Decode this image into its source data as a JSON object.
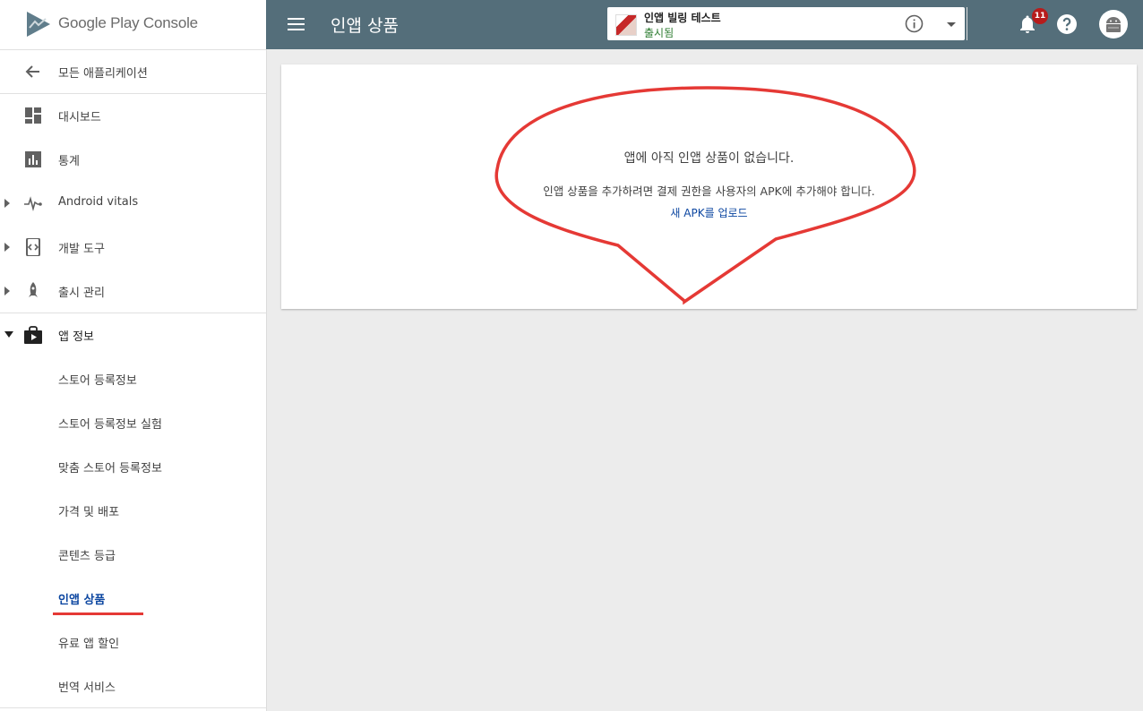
{
  "brand": {
    "name": "Google Play Console"
  },
  "sidebar": {
    "back": {
      "label": "모든 애플리케이션"
    },
    "items": [
      {
        "label": "대시보드"
      },
      {
        "label": "통계"
      },
      {
        "label": "Android vitals"
      },
      {
        "label": "개발 도구"
      },
      {
        "label": "출시 관리"
      },
      {
        "label": "앱 정보"
      }
    ],
    "sub_items": [
      {
        "label": "스토어 등록정보"
      },
      {
        "label": "스토어 등록정보 실험"
      },
      {
        "label": "맞춤 스토어 등록정보"
      },
      {
        "label": "가격 및 배포"
      },
      {
        "label": "콘텐츠 등급"
      },
      {
        "label": "인앱 상품"
      },
      {
        "label": "유료 앱 할인"
      },
      {
        "label": "번역 서비스"
      }
    ],
    "active_item": "인앱 상품"
  },
  "header": {
    "title": "인앱 상품",
    "app_selector": {
      "app_name": "인앱 빌링 테스트",
      "status": "출시됨"
    },
    "notification_count": "11"
  },
  "main": {
    "empty_state": {
      "title": "앱에 아직 인앱 상품이 없습니다.",
      "description": "인앱 상품을 추가하려면 결제 권한을 사용자의 APK에 추가해야 합니다.",
      "link": "새 APK를 업로드"
    }
  },
  "colors": {
    "topbar": "#546e7a",
    "accent_link": "#0d47a1",
    "annotation_red": "#e53935",
    "status_green": "#2e7d32",
    "badge": "#b71c1c"
  }
}
